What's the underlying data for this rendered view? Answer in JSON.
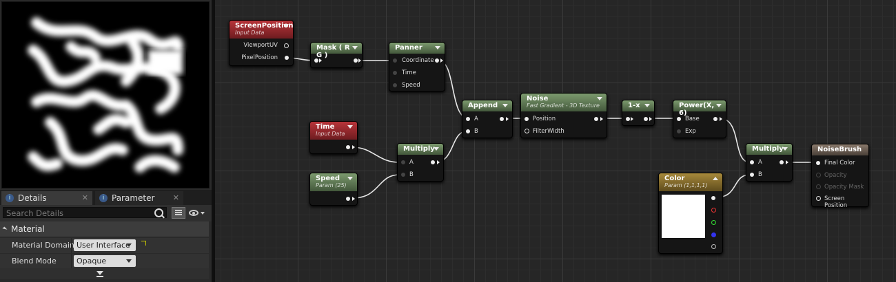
{
  "details_panel": {
    "tabs": [
      {
        "label": "Details"
      },
      {
        "label": "Parameter Defaults"
      }
    ],
    "search_placeholder": "Search Details",
    "category": "Material",
    "properties": [
      {
        "label": "Material Domain",
        "value": "User Interface"
      },
      {
        "label": "Blend Mode",
        "value": "Opaque"
      }
    ]
  },
  "graph": {
    "nodes": {
      "screen_position": {
        "title": "ScreenPosition",
        "subtitle": "Input Data",
        "outputs": [
          "ViewportUV",
          "PixelPosition"
        ]
      },
      "mask": {
        "title": "Mask ( R G )"
      },
      "panner": {
        "title": "Panner",
        "inputs": [
          "Coordinate",
          "Time",
          "Speed"
        ]
      },
      "time": {
        "title": "Time",
        "subtitle": "Input Data"
      },
      "speed": {
        "title": "Speed",
        "subtitle": "Param (25)"
      },
      "multiply1": {
        "title": "Multiply",
        "inputs": [
          "A",
          "B"
        ]
      },
      "append": {
        "title": "Append",
        "inputs": [
          "A",
          "B"
        ]
      },
      "noise": {
        "title": "Noise",
        "subtitle": "Fast Gradient - 3D Texture",
        "inputs": [
          "Position",
          "FilterWidth"
        ]
      },
      "one_minus": {
        "title": "1-x"
      },
      "power": {
        "title": "Power(X, 6)",
        "inputs": [
          "Base",
          "Exp"
        ]
      },
      "multiply2": {
        "title": "Multiply",
        "inputs": [
          "A",
          "B"
        ]
      },
      "color": {
        "title": "Color",
        "subtitle": "Param (1,1,1,1)"
      },
      "noise_brush": {
        "title": "NoiseBrush",
        "inputs": [
          "Final Color",
          "Opacity",
          "Opacity Mask",
          "Screen Position"
        ]
      }
    }
  },
  "colors": {
    "graph_bg": "#262626",
    "node_green": "#6f8b61",
    "node_red": "#a92f35",
    "node_gold": "#9a7e34"
  }
}
